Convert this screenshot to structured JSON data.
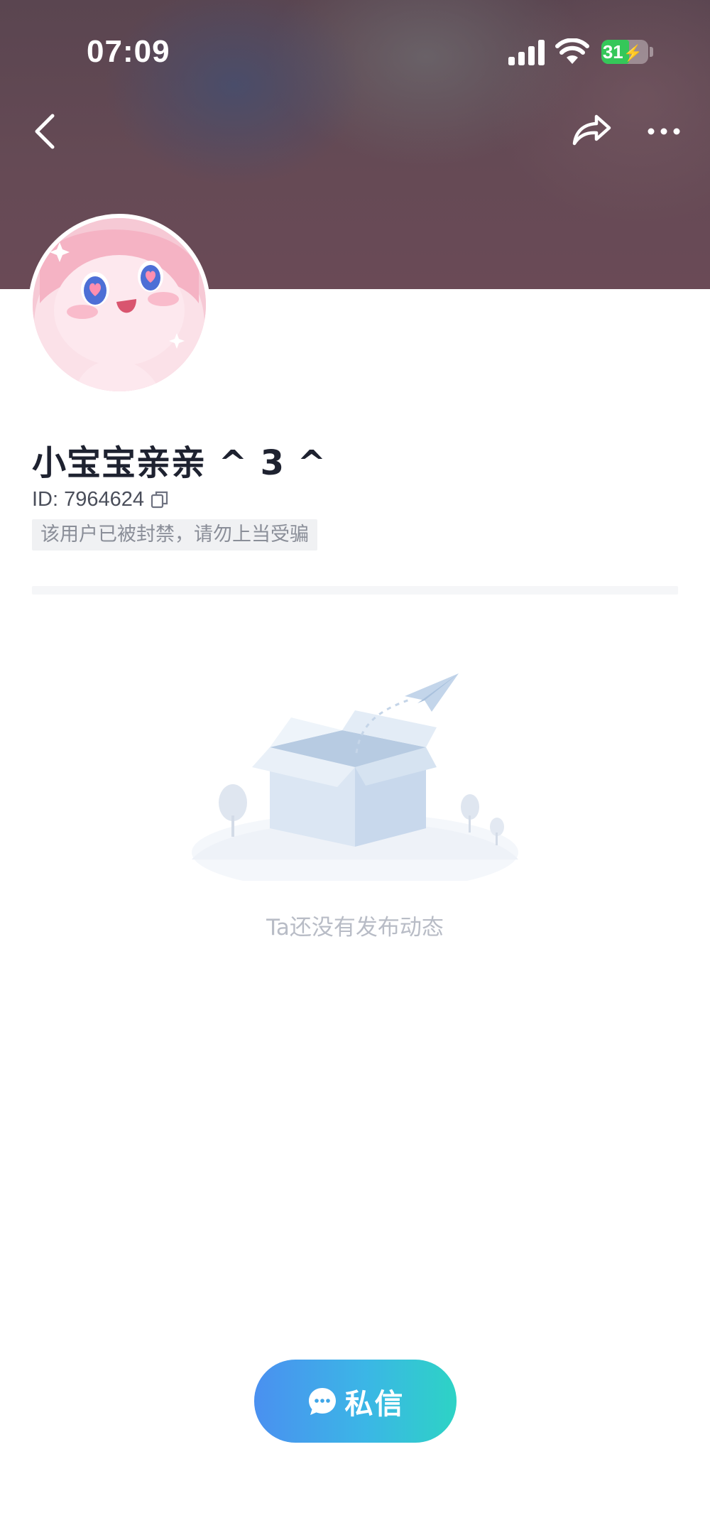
{
  "status_bar": {
    "time": "07:09",
    "battery": "31",
    "battery_level_percent": 31,
    "icons": [
      "signal-icon",
      "wifi-icon",
      "battery-icon"
    ]
  },
  "nav": {
    "icons": [
      "back-icon",
      "share-icon",
      "more-icon"
    ]
  },
  "profile": {
    "name": "小宝宝亲亲 ^ 3 ^",
    "id_text": "ID: 7964624",
    "ban_notice": "该用户已被封禁，请勿上当受骗"
  },
  "empty_state": {
    "icon": "empty-box-icon",
    "text": "Ta还没有发布动态"
  },
  "actions": {
    "message_label": "私信",
    "message_icon": "chat-bubble-icon"
  },
  "colors": {
    "header_bg": "#654a55",
    "button_gradient_start": "#4a90f0",
    "button_gradient_end": "#2dd3c5",
    "battery_green": "#35c759"
  }
}
